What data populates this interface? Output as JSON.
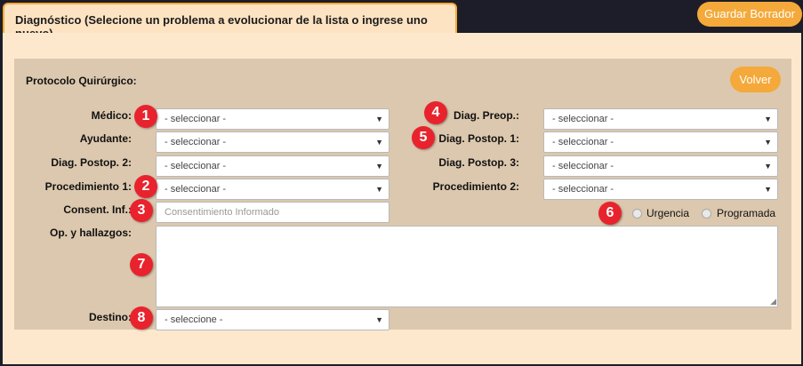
{
  "header": {
    "tab_title": "Diagnóstico (Selecione un problema a evolucionar de la lista o ingrese uno nuevo)",
    "save_draft_label": "Guardar Borrador"
  },
  "section": {
    "title": "Protocolo Quirúrgico:",
    "back_label": "Volver"
  },
  "form": {
    "medico": {
      "label": "Médico:",
      "value": "- seleccionar -"
    },
    "ayudante": {
      "label": "Ayudante:",
      "value": "- seleccionar -"
    },
    "diag_postop_2": {
      "label": "Diag. Postop. 2:",
      "value": "- seleccionar -"
    },
    "procedimiento_1": {
      "label": "Procedimiento 1:",
      "value": "- seleccionar -"
    },
    "consent": {
      "label": "Consent. Inf.:",
      "placeholder": "Consentimiento Informado"
    },
    "op_hallazgos": {
      "label": "Op. y hallazgos:"
    },
    "destino": {
      "label": "Destino:",
      "value": "- seleccione -"
    },
    "diag_preop": {
      "label": "Diag. Preop.:",
      "value": "- seleccionar -"
    },
    "diag_postop_1": {
      "label": "Diag. Postop. 1:",
      "value": "- seleccionar -"
    },
    "diag_postop_3": {
      "label": "Diag. Postop. 3:",
      "value": "- seleccionar -"
    },
    "procedimiento_2": {
      "label": "Procedimiento 2:",
      "value": "- seleccionar -"
    },
    "tipo": {
      "option_1": "Urgencia",
      "option_2": "Programada"
    }
  },
  "badges": [
    "1",
    "2",
    "3",
    "4",
    "5",
    "6",
    "7",
    "8"
  ],
  "icons": {
    "dropdown": "▼",
    "resize": "◢"
  },
  "colors": {
    "accent": "#f4a93a",
    "badge": "#e8232d",
    "panel": "#fde8ce",
    "section": "#dcc8ae"
  }
}
